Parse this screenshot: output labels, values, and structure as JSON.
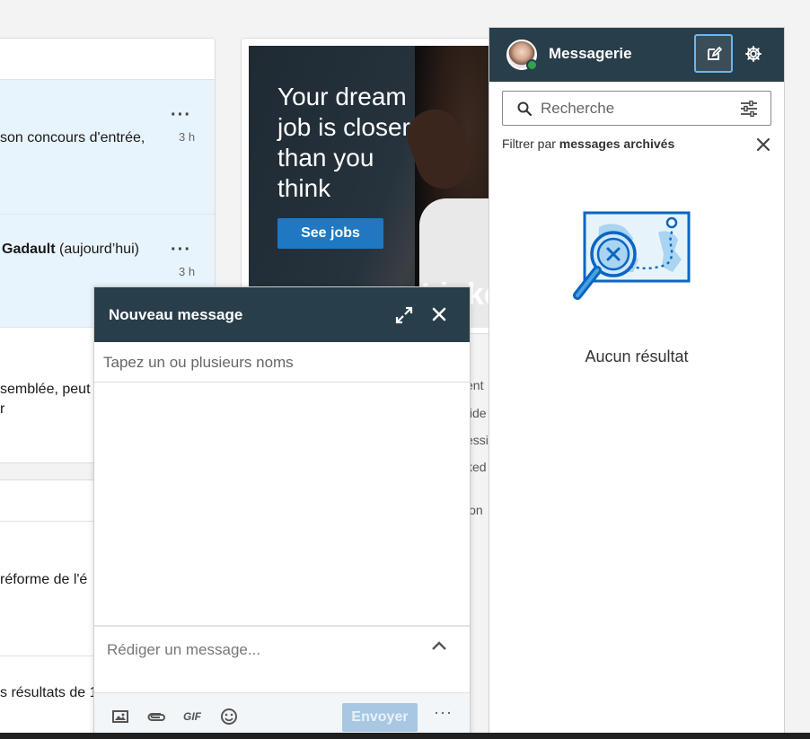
{
  "feed": {
    "notifications": [
      {
        "text": "son concours d'entrée,",
        "time": "3 h",
        "more": "···"
      },
      {
        "name": "Gadault",
        "text_suffix": " (aujourd’hui)",
        "time": "3 h",
        "more": "···"
      }
    ],
    "snippets": [
      "semblée, peut",
      "r"
    ],
    "snippets2": [
      "réforme de l'é",
      "s résultats de 1"
    ]
  },
  "ad": {
    "headline": "Your dream job is closer than you think",
    "cta": "See jobs",
    "brand": "Linke",
    "side_fragments": [
      "ent",
      "fide",
      "essi",
      "ked",
      "ion"
    ]
  },
  "messaging": {
    "title": "Messagerie",
    "search_placeholder": "Recherche",
    "filter_prefix": "Filtrer par ",
    "filter_value": "messages archivés",
    "empty_state": "Aucun résultat"
  },
  "new_message": {
    "title": "Nouveau message",
    "to_placeholder": "Tapez un ou plusieurs noms",
    "compose_placeholder": "Rédiger un message...",
    "gif_label": "GIF",
    "send_label": "Envoyer",
    "more_label": "···"
  },
  "colors": {
    "header_bg": "#283e4a",
    "accent": "#1f78c1",
    "notif_bg": "#e8f4fd",
    "online": "#31a24c"
  }
}
